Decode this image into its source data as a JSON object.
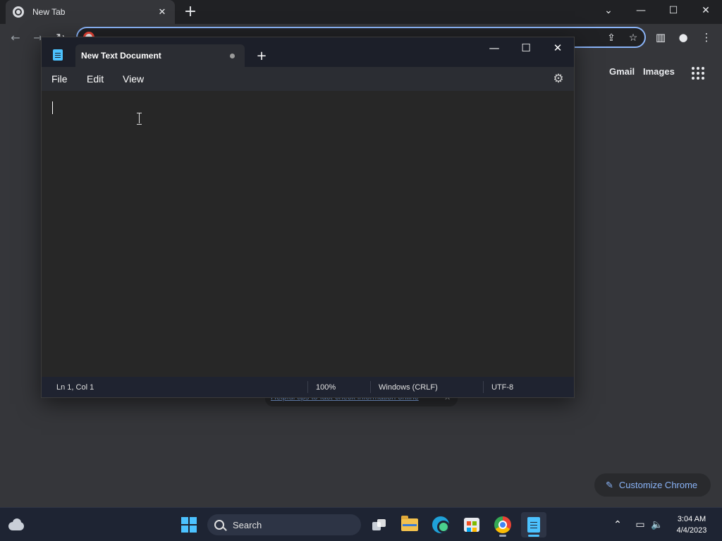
{
  "chrome": {
    "tab_title": "New Tab",
    "omnibox_value": "",
    "links": {
      "gmail": "Gmail",
      "images": "Images"
    },
    "hint_text": "Helpful tips to fact-check information online",
    "customize_label": "Customize Chrome",
    "accent_color": "#8ab4f8"
  },
  "notepad": {
    "tab_title": "New Text Document",
    "menu": {
      "file": "File",
      "edit": "Edit",
      "view": "View"
    },
    "editor_text": "",
    "status": {
      "position": "Ln 1, Col 1",
      "zoom": "100%",
      "line_ending": "Windows (CRLF)",
      "encoding": "UTF-8"
    }
  },
  "taskbar": {
    "search_label": "Search",
    "time": "3:04 AM",
    "date": "4/4/2023",
    "apps": [
      "task-view",
      "file-explorer",
      "microsoft-edge",
      "microsoft-store",
      "google-chrome",
      "notepad"
    ]
  },
  "icons": {
    "close": "✕",
    "plus": "+",
    "minimize": "—",
    "maximize": "☐",
    "chevron_down": "⌄",
    "back": "←",
    "forward": "→",
    "reload": "↻",
    "share": "⇪",
    "star": "☆",
    "side_panel": "▥",
    "profile": "●",
    "menu": "⋮",
    "gear": "⚙",
    "pencil": "✎",
    "chevron_up": "⌃",
    "network": "▭",
    "volume": "🔈"
  }
}
